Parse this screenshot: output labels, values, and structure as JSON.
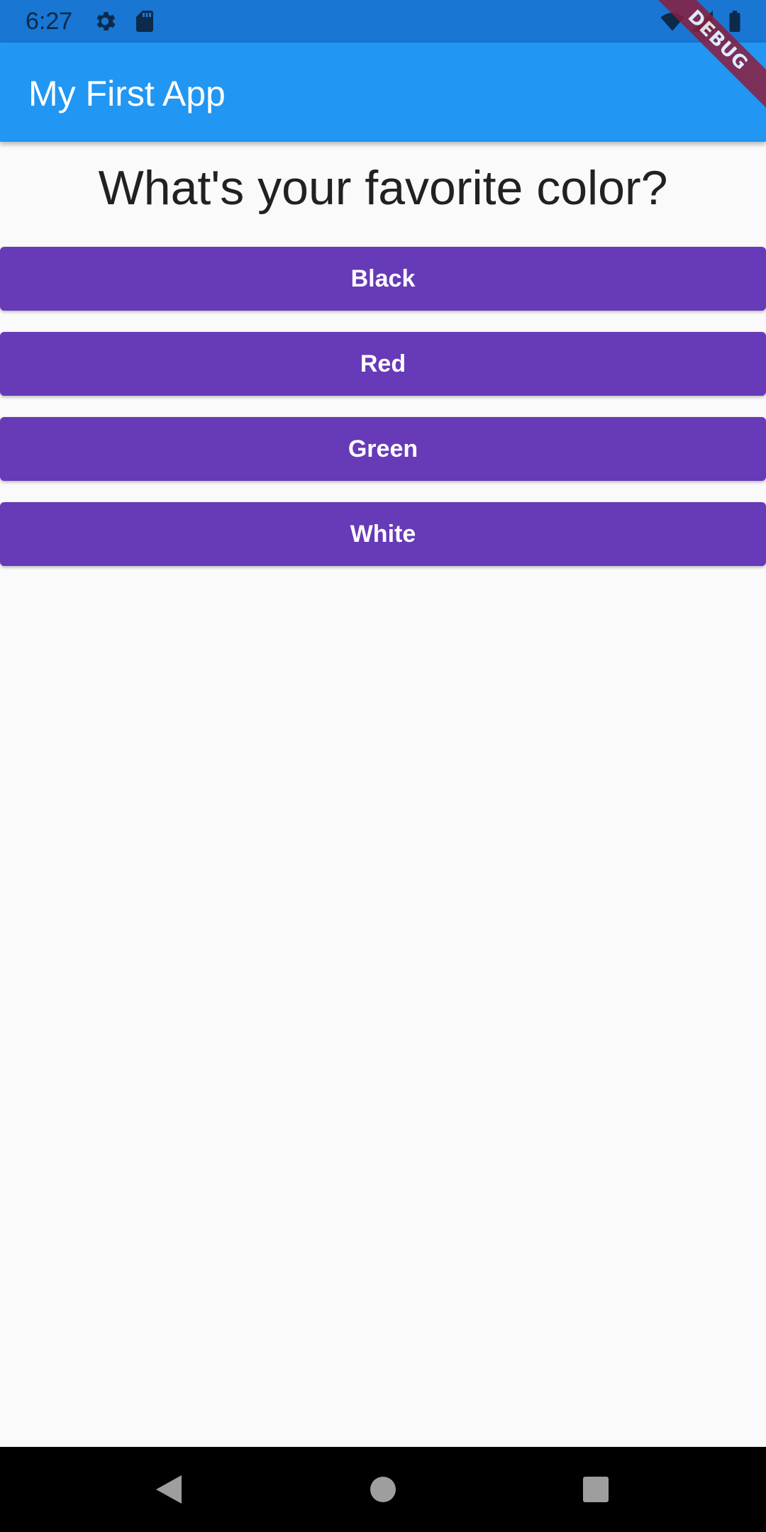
{
  "status_bar": {
    "time": "6:27",
    "left_icons": [
      "gear-icon",
      "sd-card-icon"
    ],
    "right_icons": [
      "wifi-icon",
      "signal-icon",
      "battery-icon"
    ],
    "background": "#1976d2"
  },
  "app_bar": {
    "title": "My First App",
    "background": "#2196f3"
  },
  "debug_banner": {
    "label": "DEBUG",
    "color": "#8b1e3f"
  },
  "main": {
    "question": "What's your favorite color?",
    "answers": [
      {
        "label": "Black"
      },
      {
        "label": "Red"
      },
      {
        "label": "Green"
      },
      {
        "label": "White"
      }
    ],
    "button_color": "#673ab7"
  },
  "nav_bar": {
    "buttons": [
      "back-icon",
      "home-icon",
      "recents-icon"
    ]
  }
}
